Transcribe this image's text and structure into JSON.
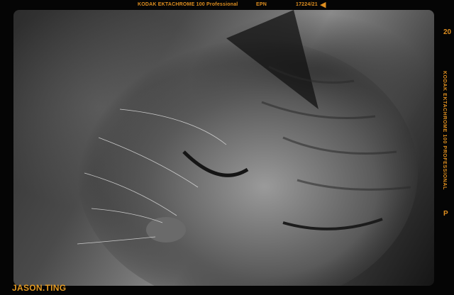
{
  "film_edge": {
    "brand": "KODAK EKTACHROME 100 Professional",
    "epn": "EPN",
    "frame_code": "17224/21",
    "arrow_icon": "frame-arrow-icon",
    "side_text": "KODAK EKTACHROME 100 PROFESSIONAL",
    "side_mark_top": "20",
    "side_mark_bottom": "P",
    "text_color": "#e08f1f"
  },
  "photo": {
    "subject": "sleeping-cat",
    "style": "black-and-white"
  },
  "signature": {
    "text": "JASON.TING"
  }
}
